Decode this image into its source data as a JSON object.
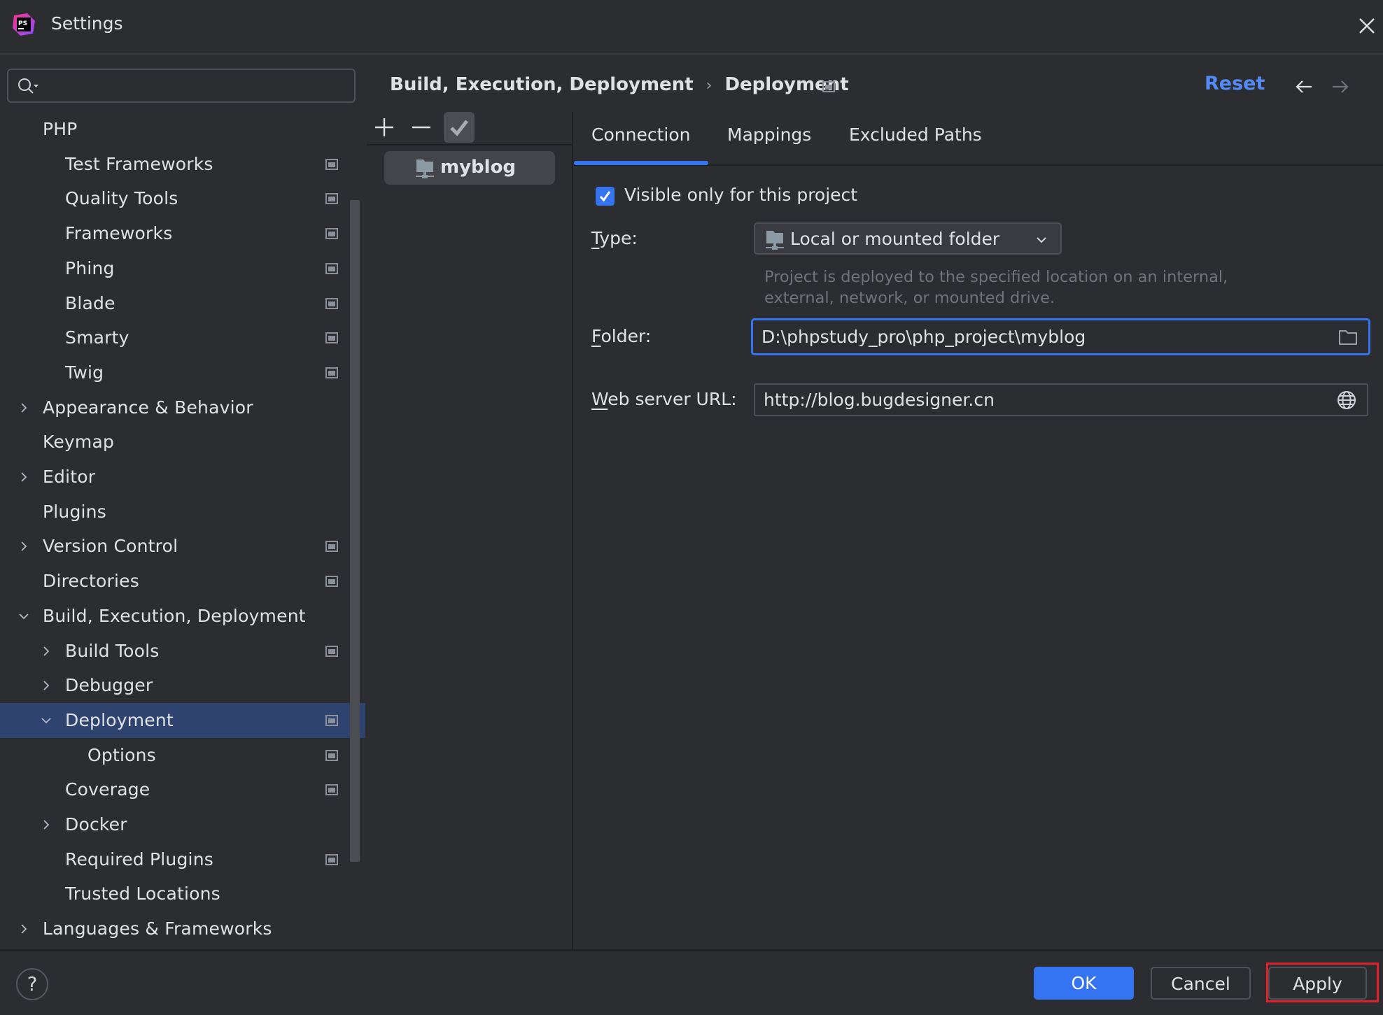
{
  "window": {
    "title": "Settings",
    "app_icon": "phpstorm-logo-icon",
    "close_icon": "close-icon"
  },
  "search": {
    "placeholder": "",
    "value": "",
    "icon": "search-icon"
  },
  "sidebar": {
    "items": [
      {
        "label": "PHP",
        "level": 0,
        "expander": "none",
        "badge": false,
        "selected": false
      },
      {
        "label": "Test Frameworks",
        "level": 1,
        "expander": "none",
        "badge": true,
        "selected": false
      },
      {
        "label": "Quality Tools",
        "level": 1,
        "expander": "none",
        "badge": true,
        "selected": false
      },
      {
        "label": "Frameworks",
        "level": 1,
        "expander": "none",
        "badge": true,
        "selected": false
      },
      {
        "label": "Phing",
        "level": 1,
        "expander": "none",
        "badge": true,
        "selected": false
      },
      {
        "label": "Blade",
        "level": 1,
        "expander": "none",
        "badge": true,
        "selected": false
      },
      {
        "label": "Smarty",
        "level": 1,
        "expander": "none",
        "badge": true,
        "selected": false
      },
      {
        "label": "Twig",
        "level": 1,
        "expander": "none",
        "badge": true,
        "selected": false
      },
      {
        "label": "Appearance & Behavior",
        "level": 0,
        "expander": "collapsed",
        "badge": false,
        "selected": false
      },
      {
        "label": "Keymap",
        "level": 0,
        "expander": "none",
        "badge": false,
        "selected": false
      },
      {
        "label": "Editor",
        "level": 0,
        "expander": "collapsed",
        "badge": false,
        "selected": false
      },
      {
        "label": "Plugins",
        "level": 0,
        "expander": "none",
        "badge": false,
        "selected": false
      },
      {
        "label": "Version Control",
        "level": 0,
        "expander": "collapsed",
        "badge": true,
        "selected": false
      },
      {
        "label": "Directories",
        "level": 0,
        "expander": "none",
        "badge": true,
        "selected": false
      },
      {
        "label": "Build, Execution, Deployment",
        "level": 0,
        "expander": "expanded",
        "badge": false,
        "selected": false
      },
      {
        "label": "Build Tools",
        "level": 1,
        "expander": "collapsed",
        "badge": true,
        "selected": false
      },
      {
        "label": "Debugger",
        "level": 1,
        "expander": "collapsed",
        "badge": false,
        "selected": false
      },
      {
        "label": "Deployment",
        "level": 1,
        "expander": "expanded",
        "badge": true,
        "selected": true
      },
      {
        "label": "Options",
        "level": 2,
        "expander": "none",
        "badge": true,
        "selected": false
      },
      {
        "label": "Coverage",
        "level": 1,
        "expander": "none",
        "badge": true,
        "selected": false
      },
      {
        "label": "Docker",
        "level": 1,
        "expander": "collapsed",
        "badge": false,
        "selected": false
      },
      {
        "label": "Required Plugins",
        "level": 1,
        "expander": "none",
        "badge": true,
        "selected": false
      },
      {
        "label": "Trusted Locations",
        "level": 1,
        "expander": "none",
        "badge": false,
        "selected": false
      },
      {
        "label": "Languages & Frameworks",
        "level": 0,
        "expander": "collapsed",
        "badge": false,
        "selected": false
      }
    ]
  },
  "header": {
    "breadcrumb": [
      "Build, Execution, Deployment",
      "Deployment"
    ],
    "breadcrumb_separator": "›",
    "reset_label": "Reset",
    "back_icon": "arrow-left-icon",
    "forward_icon": "arrow-right-icon"
  },
  "server_list": {
    "toolbar": {
      "add_icon": "plus-icon",
      "remove_icon": "minus-icon",
      "default_icon": "checkmark-icon"
    },
    "items": [
      {
        "label": "myblog",
        "icon": "network-folder-icon",
        "selected": true
      }
    ]
  },
  "tabs": [
    {
      "label": "Connection",
      "active": true
    },
    {
      "label": "Mappings",
      "active": false
    },
    {
      "label": "Excluded Paths",
      "active": false
    }
  ],
  "connection": {
    "visible_only_checkbox": {
      "label": "Visible only for this project",
      "checked": true
    },
    "type": {
      "label_mnemonic": "T",
      "label_rest": "ype:",
      "value": "Local or mounted folder",
      "hint_line1": "Project is deployed to the specified location on an internal,",
      "hint_line2": "external, network, or mounted drive."
    },
    "folder": {
      "label_mnemonic": "F",
      "label_rest": "older:",
      "value": "D:\\phpstudy_pro\\php_project\\myblog",
      "icon": "folder-icon"
    },
    "web_server_url": {
      "label_mnemonic": "W",
      "label_rest": "eb server URL:",
      "value": "http://blog.bugdesigner.cn",
      "icon": "globe-icon"
    }
  },
  "footer": {
    "help_label": "?",
    "ok_label": "OK",
    "cancel_label": "Cancel",
    "apply_label": "Apply",
    "colors": {
      "primary": "#3574f0",
      "highlight": "#e0202a"
    }
  },
  "colors": {
    "background": "#2b2d30",
    "selection": "#2e436e",
    "accent": "#3574f0",
    "link": "#548af7",
    "hint_text": "#6f737a"
  }
}
